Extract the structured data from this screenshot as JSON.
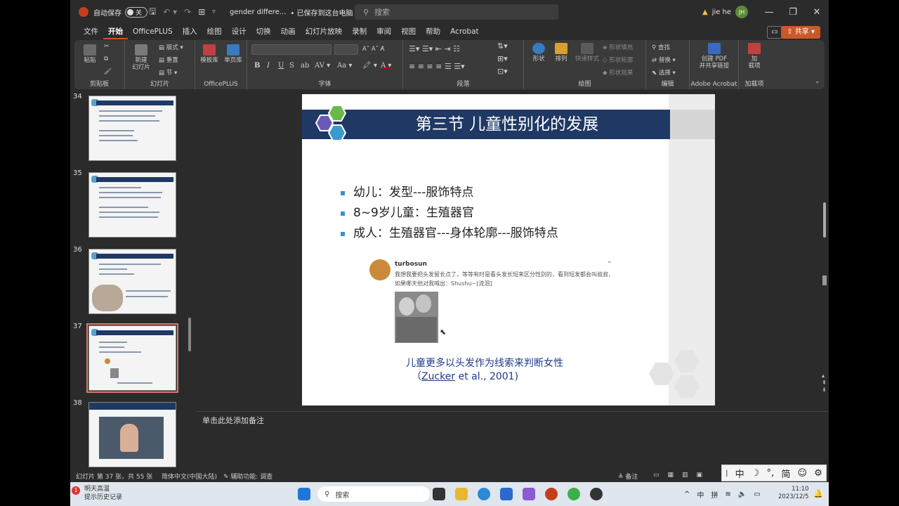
{
  "titlebar": {
    "autosave_label": "自动保存",
    "autosave_state": "关",
    "filename": "gender differe...",
    "save_status": "• 已保存到这台电脑",
    "search_placeholder": "搜索",
    "user_name": "jie he",
    "user_initials": "JH"
  },
  "tabs": [
    "文件",
    "开始",
    "OfficePLUS",
    "插入",
    "绘图",
    "设计",
    "切换",
    "动画",
    "幻灯片放映",
    "录制",
    "审阅",
    "视图",
    "帮助",
    "Acrobat"
  ],
  "active_tab": "开始",
  "share_label": "共享",
  "ribbon": {
    "groups": {
      "clipboard": "剪贴板",
      "slides": "幻灯片",
      "officeplus": "OfficePLUS",
      "font": "字体",
      "paragraph": "段落",
      "drawing": "绘图",
      "editing": "编辑",
      "acrobat": "Adobe Acrobat",
      "addins": "加载项"
    },
    "paste": "粘贴",
    "new_slide": "新建\n幻灯片",
    "layout": "版式",
    "reset": "重置",
    "section": "节",
    "template_lib": "模板库",
    "single_page_lib": "单页库",
    "shapes": "形状",
    "arrange": "排列",
    "quick_styles": "快速样式",
    "shape_fill": "形状填充",
    "shape_outline": "形状轮廓",
    "shape_effects": "形状效果",
    "find": "查找",
    "replace": "替换",
    "select": "选择",
    "create_pdf": "创建 PDF\n并共享链接",
    "addins_btn": "加\n载项"
  },
  "thumbnails": [
    {
      "num": "34"
    },
    {
      "num": "35"
    },
    {
      "num": "36"
    },
    {
      "num": "37"
    },
    {
      "num": "38"
    }
  ],
  "slide": {
    "title": "第三节 儿童性别化的发展",
    "bullets": [
      "幼儿：发型---服饰特点",
      "8~9岁儿童：生殖器官",
      "成人：生殖器官---身体轮廓---服饰特点"
    ],
    "weibo_name": "turbosun",
    "weibo_text": "我想我要把头发留长点了，等等有时是看头发长短来区分性别的，看到短发都会叫叔叔，如果哪天他对我喊出：Shushu~[流泪]",
    "caption": "儿童更多以头发作为线索来判断女性",
    "citation_author": "Zucker",
    "citation_rest": " et al., 2001)",
    "citation_open": "（"
  },
  "notes_placeholder": "单击此处添加备注",
  "status": {
    "slide_info": "幻灯片 第 37 张，共 55 张",
    "language": "简体中文(中国大陆)",
    "accessibility": "辅助功能: 调查",
    "notes_btn": "备注"
  },
  "ime": [
    "中",
    "简"
  ],
  "taskbar": {
    "weather_line1": "明天高温",
    "weather_line2": "提示历史记录",
    "weather_badge": "1",
    "search": "搜索",
    "lang1": "中",
    "lang2": "拼",
    "time": "11:10",
    "date": "2023/12/5"
  },
  "colors": {
    "accent": "#d35230",
    "slide_title_bg": "#1f3864",
    "caption": "#1f3a8a",
    "bullet": "#3d8fc6"
  }
}
